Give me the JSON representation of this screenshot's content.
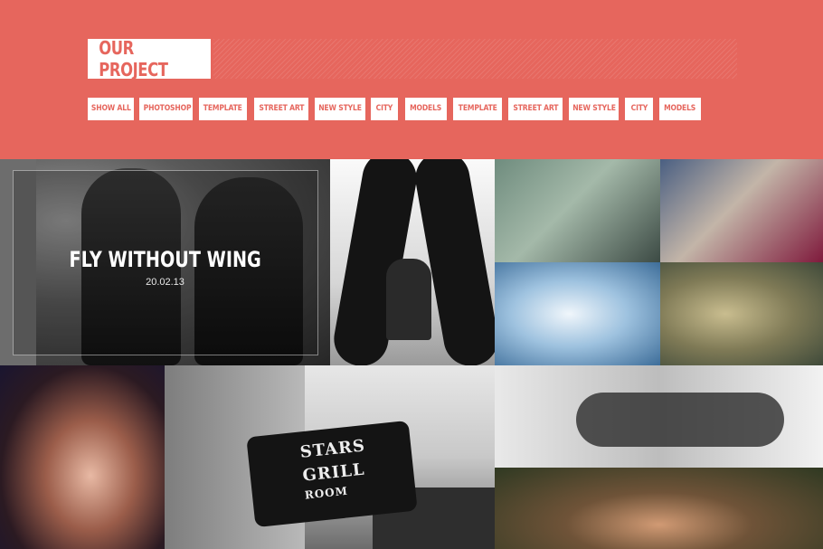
{
  "header": {
    "title": "OUR PROJECT"
  },
  "filters": [
    "SHOW ALL",
    "PHOTOSHOP",
    "TEMPLATE",
    "STREET ART",
    "NEW STYLE",
    "CITY",
    "MODELS",
    "TEMPLATE",
    "STREET ART",
    "NEW STYLE",
    "CITY",
    "MODELS"
  ],
  "featured": {
    "title": "FLY WITHOUT WING",
    "date": "20.02.13"
  },
  "sign": {
    "line1": "STARS",
    "line2": "GRILL",
    "line3": "ROOM"
  },
  "colors": {
    "accent": "#e6665d",
    "button_bg": "#ffffff"
  }
}
